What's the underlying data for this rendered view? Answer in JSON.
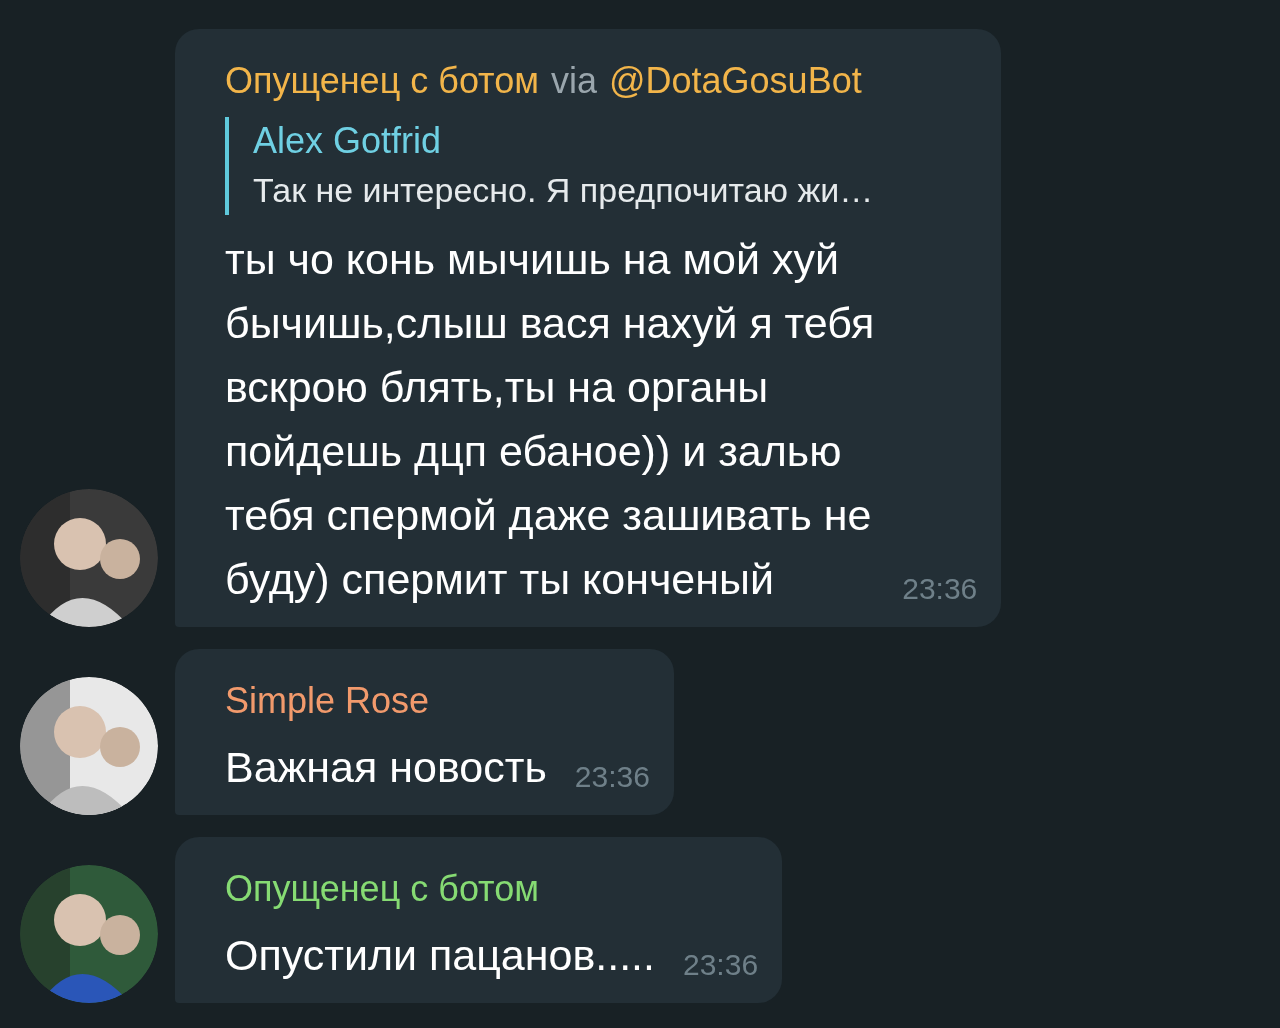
{
  "messages": [
    {
      "sender": "Опущенец с ботом",
      "color": "#f2b54a",
      "via_label": "via",
      "via_bot": "@DotaGosuBot",
      "reply": {
        "author": "Alex Gotfrid",
        "text": "Так не интересно. Я предпочитаю жи…"
      },
      "text": "ты чо конь мычишь на мой хуй\nбычишь,слыш вася нахуй я тебя\nвскрою блять,ты на органы\nпойдешь дцп ебаное)) и залью\nтебя спермой даже зашивать не\nбуду) спермит ты конченый",
      "time": "23:36"
    },
    {
      "sender": "Simple Rose",
      "color": "#f29a6c",
      "text": "Важная новость",
      "time": "23:36"
    },
    {
      "sender": "Опущенец с ботом",
      "color": "#86db73",
      "text": "Опустили пацанов.....",
      "time": "23:36"
    }
  ]
}
